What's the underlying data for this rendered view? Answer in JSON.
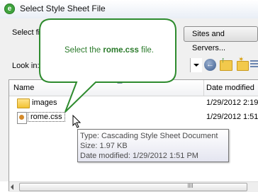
{
  "window": {
    "title": "Select Style Sheet File",
    "app_icon": "dreamweaver-green-icon"
  },
  "dialog": {
    "select_from_label": "Select fi",
    "sites_button_label": "Sites and Servers...",
    "look_in_label": "Look in:",
    "toolbar_icons": [
      "back-arrow-icon",
      "up-folder-icon",
      "new-folder-icon",
      "view-menu-icon"
    ]
  },
  "file_list": {
    "columns": [
      "Name",
      "Date modified"
    ],
    "rows": [
      {
        "name": "images",
        "date": "1/29/2012 2:19",
        "icon": "folder-icon"
      },
      {
        "name": "rome.css",
        "date": "1/29/2012 1:51",
        "icon": "css-file-icon"
      }
    ]
  },
  "callout": {
    "prefix": "Select the ",
    "bold": "rome.css",
    "suffix": " file."
  },
  "tooltip": {
    "type_line": "Type: Cascading Style Sheet Document",
    "size_line": "Size: 1.97 KB",
    "date_line": "Date modified: 1/29/2012 1:51 PM"
  },
  "colors": {
    "callout_fill": "#ffffff",
    "callout_border": "#2e8b2e",
    "callout_text": "#2a7a2a"
  }
}
